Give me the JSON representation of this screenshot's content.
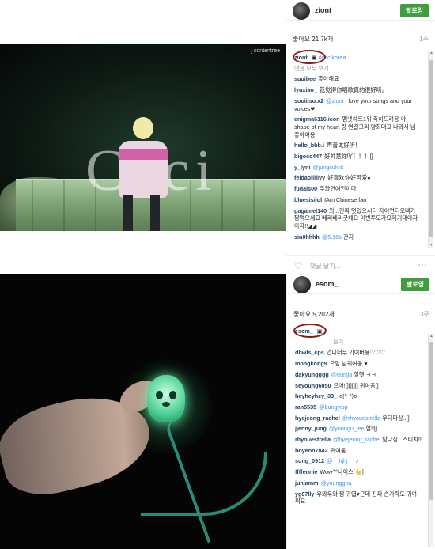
{
  "post1": {
    "watermark": "j contentree",
    "photo_logo": "Ceci",
    "header": {
      "username": "ziont",
      "follow_label": "팔로잉"
    },
    "likes": "좋아요 21.7k개",
    "time": "1주",
    "owner": {
      "username": "ziont",
      "caption": "#ceci​korea"
    },
    "load_more": "댓글 모두 보기",
    "comments": [
      {
        "user": "suuibee",
        "text": "좋아해요"
      },
      {
        "user": "lyuxiao_",
        "text": "我觉得你唱歌真的很好听。"
      },
      {
        "user": "sooiiiso.x2",
        "text": "I love your songs and your voices❤",
        "mention": "@ziont"
      },
      {
        "user": "enigma6116.icon",
        "text": "멤넷차트1위 축하드려용 아 shape of my heart 랑 연결고리 양화대교 나와서 넘 좋아여용"
      },
      {
        "user": "hello_bbb.i",
        "text": "声音太好听！"
      },
      {
        "user": "bigocc447",
        "text": "好帅意你吖！！！[]"
      },
      {
        "user": "y_lyni",
        "text": "",
        "mention": "@jungsukkk"
      },
      {
        "user": "feidaoliilivv",
        "text": "好喜欢你好可爱♠"
      },
      {
        "user": "fudals00",
        "text": "우와연예인이다"
      },
      {
        "user": "bluesisilol",
        "text": "IAm Chinese fan"
      },
      {
        "user": "gagamel140",
        "text": "와...진짜 멋있으시다 자이언티오빠가 짱먹으세요 베리베리굿해요 이번투도가요제기대아자아자!!◢◢"
      },
      {
        "user": "sin0hhhh",
        "text": "간지",
        "mention": "@5.16s"
      }
    ],
    "comment_placeholder": "댓글 달기...",
    "more_icon": "···"
  },
  "post2": {
    "header": {
      "username": "esom_",
      "follow_label": "팔로잉"
    },
    "likes": "좋아요 5,202개",
    "time": "3주",
    "owner": {
      "username": "esom_"
    },
    "load_more": "보기",
    "comments": [
      {
        "user": "dbwls_cps",
        "text": "언니너무 기여버용♡♡♡"
      },
      {
        "user": "mongkong9",
        "text": "으앙 넘귀여웅 ♥"
      },
      {
        "user": "dakyungggg",
        "text": "헐헷 ㅋㅋ",
        "mention": "@eunjja"
      },
      {
        "user": "seyoung6050",
        "text": "으어![][][][] 귀여움[]"
      },
      {
        "user": "heyheyhey_33_",
        "text": "o(^-^)o"
      },
      {
        "user": "ran5535",
        "text": "",
        "mention": "@bungyipp"
      },
      {
        "user": "hyejeong_rachel",
        "text": "우디파상..[]",
        "mention": "@rhyouestrella"
      },
      {
        "user": "jjenny_jung",
        "text": "헐!![]",
        "mention": "@yoongu_lee"
      },
      {
        "user": "rhyouestrella",
        "text": "탐나징.. 스티치!!",
        "mention": "@hyejeong_rachel"
      },
      {
        "user": "boyeon7842",
        "text": "귀여움"
      },
      {
        "user": "sung_0912",
        "text": "♪",
        "mention": "@__hjhj__"
      },
      {
        "user": "ffffennie",
        "text": "Wow^^나이스[👆]"
      },
      {
        "user": "junjamm",
        "text": "",
        "mention": "@younggha"
      },
      {
        "user": "yg07lly",
        "text": "우와우와 짱 귀엽♥근데 진짜 손가락도 귀여워요"
      }
    ],
    "comment_placeholder": "댓글 달기...",
    "more_icon": "···"
  },
  "colors": {
    "follow_green": "#3f9d3f",
    "username_blue": "#1c3e5e",
    "mention_blue": "#3897f0",
    "owner_circle": "#8b1a1a"
  },
  "icons": {
    "heart": "heart-icon",
    "more": "more-options-icon",
    "scroll_up": "scroll-up-arrow-icon",
    "scroll_down": "scroll-down-arrow-icon"
  }
}
